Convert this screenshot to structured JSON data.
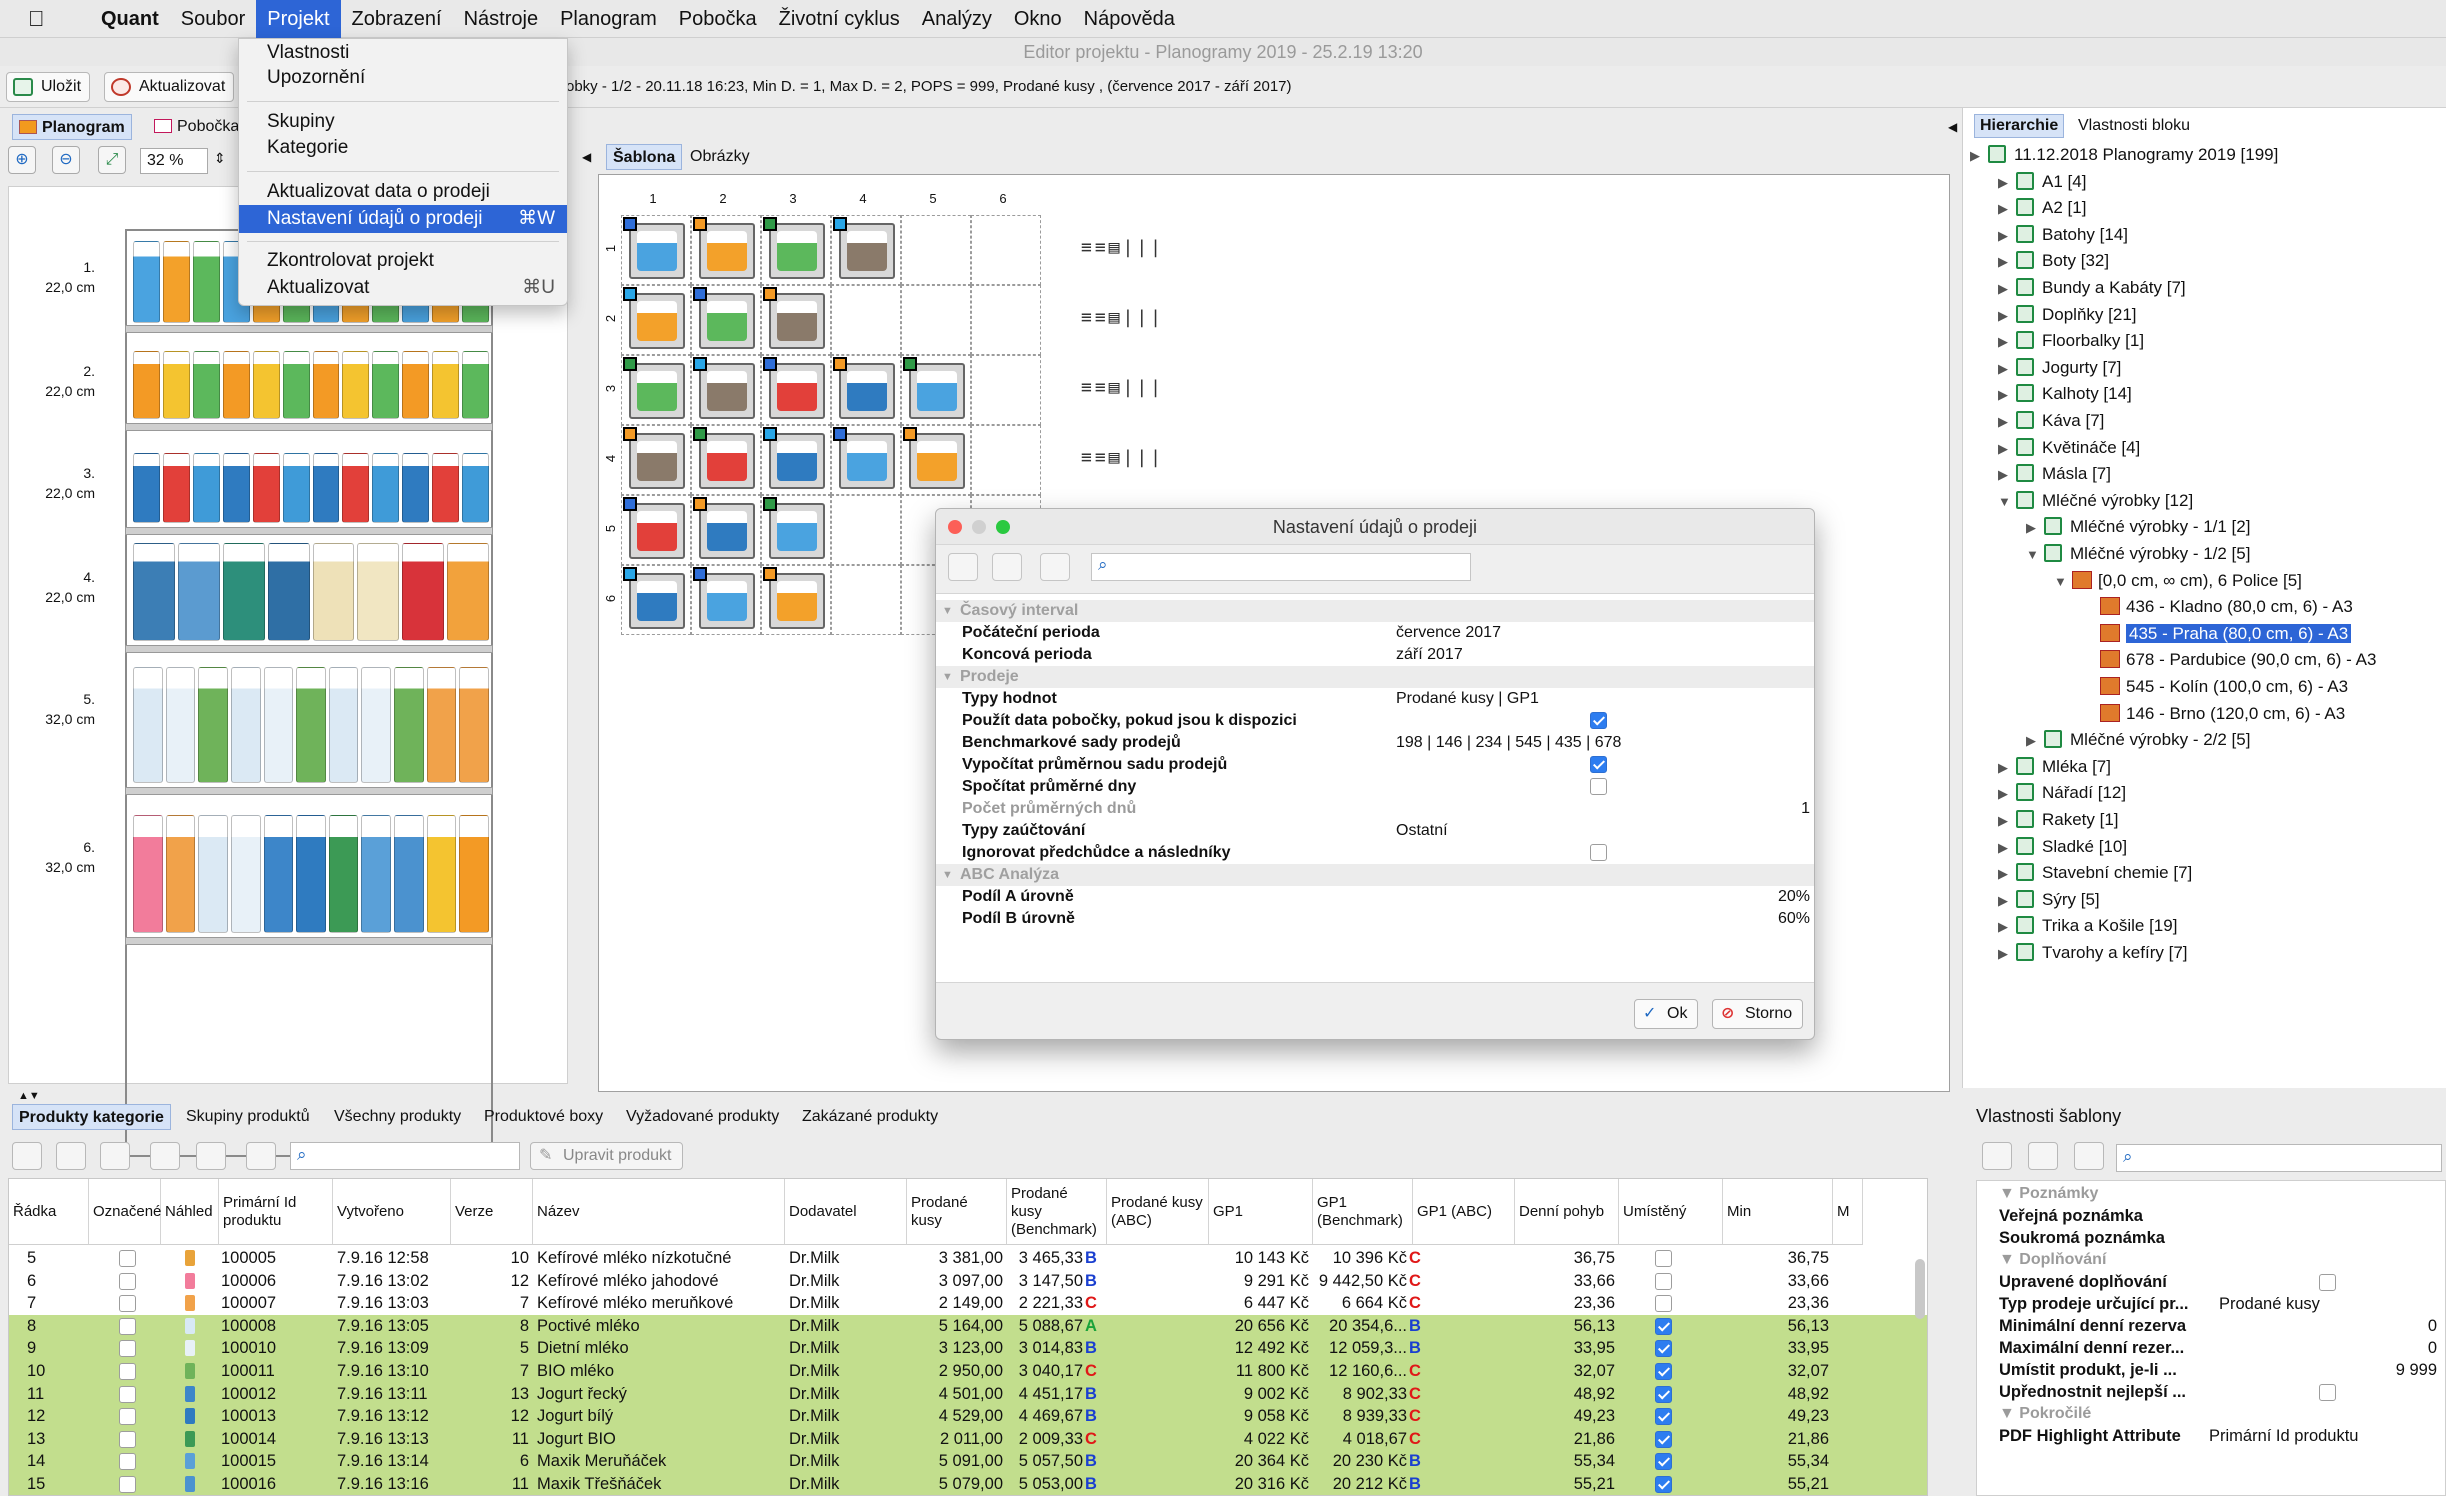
{
  "menubar": {
    "apple": "",
    "items": [
      "Quant",
      "Soubor",
      "Projekt",
      "Zobrazení",
      "Nástroje",
      "Planogram",
      "Pobočka",
      "Životní cyklus",
      "Analýzy",
      "Okno",
      "Nápověda"
    ]
  },
  "window_title": "Editor projektu - Planogramy 2019 - 25.2.19 13:20",
  "toolbar": {
    "save": "Uložit",
    "update": "Aktualizovat",
    "info": "obky - 1/2 - 20.11.18 16:23, Min D. = 1, Max D. = 2, POPS = 999, Prodané kusy , (července 2017 - září 2017)"
  },
  "left_tabs": {
    "planogram": "Planogram",
    "branch": "Pobočka"
  },
  "zoom": "32 %",
  "shelves": [
    {
      "num": "1.",
      "height": "22,0 cm"
    },
    {
      "num": "2.",
      "height": "22,0 cm"
    },
    {
      "num": "3.",
      "height": "22,0 cm"
    },
    {
      "num": "4.",
      "height": "22,0 cm"
    },
    {
      "num": "5.",
      "height": "32,0 cm"
    },
    {
      "num": "6.",
      "height": "32,0 cm"
    }
  ],
  "center_tabs": {
    "template": "Šablona",
    "images": "Obrázky"
  },
  "template_grid": {
    "columns": [
      "1",
      "2",
      "3",
      "4",
      "5",
      "6"
    ],
    "rows": [
      "1",
      "2",
      "3",
      "4",
      "5",
      "6"
    ]
  },
  "dropdown": {
    "items": [
      {
        "label": "Vlastnosti"
      },
      {
        "label": "Upozornění"
      },
      {
        "label": "Skupiny"
      },
      {
        "label": "Kategorie"
      },
      {
        "label": "Aktualizovat data o prodeji"
      },
      {
        "label": "Nastavení údajů o prodeji",
        "shortcut": "⌘W",
        "highlighted": true
      },
      {
        "label": "Zkontrolovat projekt"
      },
      {
        "label": "Aktualizovat",
        "shortcut": "⌘U"
      }
    ]
  },
  "dialog": {
    "title": "Nastavení údajů o prodeji",
    "groups": {
      "time": "Časový interval",
      "sales": "Prodeje",
      "abc": "ABC Analýza"
    },
    "rows": {
      "start": {
        "key": "Počáteční perioda",
        "value": "července 2017"
      },
      "end": {
        "key": "Koncová perioda",
        "value": "září 2017"
      },
      "types": {
        "key": "Typy hodnot",
        "value": "Prodané kusy  | GP1"
      },
      "branch_data": {
        "key": "Použít data pobočky, pokud jsou k dispozici",
        "checked": true
      },
      "bench": {
        "key": "Benchmarkové sady prodejů",
        "value": "198 | 146 | 234 | 545 | 435 | 678"
      },
      "avg_set": {
        "key": "Vypočítat průměrnou sadu prodejů",
        "checked": true
      },
      "avg_days": {
        "key": "Spočítat průměrné dny",
        "checked": false
      },
      "num_days": {
        "key": "Počet průměrných dnů",
        "value": "1"
      },
      "posting": {
        "key": "Typy zaúčtování",
        "value": "Ostatní"
      },
      "ignore": {
        "key": "Ignorovat předchůdce a následníky",
        "checked": false
      },
      "share_a": {
        "key": "Podíl A úrovně",
        "value": "20%"
      },
      "share_b": {
        "key": "Podíl B úrovně",
        "value": "60%"
      }
    },
    "ok": "Ok",
    "cancel": "Storno"
  },
  "right_tabs": {
    "hierarchy": "Hierarchie",
    "block_props": "Vlastnosti bloku"
  },
  "tree": [
    {
      "label": "11.12.2018 Planogramy 2019 [199]",
      "level": 0,
      "arrow": "▶"
    },
    {
      "label": "A1 [4]",
      "level": 1,
      "arrow": "▶"
    },
    {
      "label": "A2 [1]",
      "level": 1,
      "arrow": "▶"
    },
    {
      "label": "Batohy [14]",
      "level": 1,
      "arrow": "▶"
    },
    {
      "label": "Boty [32]",
      "level": 1,
      "arrow": "▶"
    },
    {
      "label": "Bundy a Kabáty [7]",
      "level": 1,
      "arrow": "▶"
    },
    {
      "label": "Doplňky [21]",
      "level": 1,
      "arrow": "▶"
    },
    {
      "label": "Floorbalky [1]",
      "level": 1,
      "arrow": "▶"
    },
    {
      "label": "Jogurty [7]",
      "level": 1,
      "arrow": "▶"
    },
    {
      "label": "Kalhoty [14]",
      "level": 1,
      "arrow": "▶"
    },
    {
      "label": "Káva [7]",
      "level": 1,
      "arrow": "▶"
    },
    {
      "label": "Květináče [4]",
      "level": 1,
      "arrow": "▶"
    },
    {
      "label": "Másla [7]",
      "level": 1,
      "arrow": "▶"
    },
    {
      "label": "Mléčné výrobky [12]",
      "level": 1,
      "arrow": "▼"
    },
    {
      "label": "Mléčné výrobky - 1/1 [2]",
      "level": 2,
      "arrow": "▶"
    },
    {
      "label": "Mléčné výrobky - 1/2 [5]",
      "level": 2,
      "arrow": "▼"
    },
    {
      "label": "[0,0 cm, ∞ cm), 6 Police [5]",
      "level": 3,
      "arrow": "▼",
      "store": true
    },
    {
      "label": "436 - Kladno (80,0 cm, 6) - A3",
      "level": 4,
      "arrow": "",
      "store": true
    },
    {
      "label": "435 - Praha  (80,0 cm, 6) - A3",
      "level": 4,
      "arrow": "",
      "store": true,
      "selected": true
    },
    {
      "label": "678 - Pardubice  (90,0 cm, 6) - A3",
      "level": 4,
      "arrow": "",
      "store": true
    },
    {
      "label": "545 - Kolín (100,0 cm, 6) - A3",
      "level": 4,
      "arrow": "",
      "store": true
    },
    {
      "label": "146 - Brno (120,0 cm, 6) - A3",
      "level": 4,
      "arrow": "",
      "store": true
    },
    {
      "label": "Mléčné výrobky - 2/2 [5]",
      "level": 2,
      "arrow": "▶"
    },
    {
      "label": "Mléka [7]",
      "level": 1,
      "arrow": "▶"
    },
    {
      "label": "Nářadí [12]",
      "level": 1,
      "arrow": "▶"
    },
    {
      "label": "Rakety [1]",
      "level": 1,
      "arrow": "▶"
    },
    {
      "label": "Sladké [10]",
      "level": 1,
      "arrow": "▶"
    },
    {
      "label": "Stavební chemie [7]",
      "level": 1,
      "arrow": "▶"
    },
    {
      "label": "Sýry [5]",
      "level": 1,
      "arrow": "▶"
    },
    {
      "label": "Trika a Košile [19]",
      "level": 1,
      "arrow": "▶"
    },
    {
      "label": "Tvarohy a kefíry [7]",
      "level": 1,
      "arrow": "▶"
    }
  ],
  "bottom_tabs": [
    "Produkty kategorie",
    "Skupiny produktů",
    "Všechny produkty",
    "Produktové boxy",
    "Vyžadované produkty",
    "Zakázané produkty"
  ],
  "edit_product": "Upravit produkt",
  "grid": {
    "headers": [
      "Řádka",
      "Označené",
      "Náhled",
      "Primární Id produktu",
      "Vytvořeno",
      "Verze",
      "Název",
      "Dodavatel",
      "Prodané kusy",
      "Prodané kusy (Benchmark)",
      "Prodané kusy  (ABC)",
      "GP1",
      "GP1 (Benchmark)",
      "GP1 (ABC)",
      "Denní pohyb",
      "Umístěný",
      "Min",
      "M"
    ],
    "rows": [
      {
        "row": "5",
        "id": "100005",
        "created": "7.9.16 12:58",
        "ver": "10",
        "name": "Kefírové mléko nízkotučné",
        "sup": "Dr.Milk",
        "sold": "3 381,00",
        "bench": "3 465,33",
        "abc": "B",
        "gp1": "10 143 Kč",
        "gp1b": "10 396 Kč",
        "gp1abc": "C",
        "daily": "36,75",
        "placed": false,
        "min": "36,75",
        "green": false,
        "swatch": "#e8a33a"
      },
      {
        "row": "6",
        "id": "100006",
        "created": "7.9.16 13:02",
        "ver": "12",
        "name": "Kefírové mléko jahodové",
        "sup": "Dr.Milk",
        "sold": "3 097,00",
        "bench": "3 147,50",
        "abc": "B",
        "gp1": "9 291 Kč",
        "gp1b": "9 442,50 Kč",
        "gp1abc": "C",
        "daily": "33,66",
        "placed": false,
        "min": "33,66",
        "green": false,
        "swatch": "#f27c9b"
      },
      {
        "row": "7",
        "id": "100007",
        "created": "7.9.16 13:03",
        "ver": "7",
        "name": "Kefírové mléko meruňkové",
        "sup": "Dr.Milk",
        "sold": "2 149,00",
        "bench": "2 221,33",
        "abc": "C",
        "gp1": "6 447 Kč",
        "gp1b": "6 664 Kč",
        "gp1abc": "C",
        "daily": "23,36",
        "placed": false,
        "min": "23,36",
        "green": false,
        "swatch": "#f1a24a"
      },
      {
        "row": "8",
        "id": "100008",
        "created": "7.9.16 13:05",
        "ver": "8",
        "name": "Poctivé mléko",
        "sup": "Dr.Milk",
        "sold": "5 164,00",
        "bench": "5 088,67",
        "abc": "A",
        "gp1": "20 656 Kč",
        "gp1b": "20 354,6...",
        "gp1abc": "B",
        "daily": "56,13",
        "placed": true,
        "min": "56,13",
        "green": true,
        "swatch": "#d8e9f5"
      },
      {
        "row": "9",
        "id": "100010",
        "created": "7.9.16 13:09",
        "ver": "5",
        "name": "Dietní mléko",
        "sup": "Dr.Milk",
        "sold": "3 123,00",
        "bench": "3 014,83",
        "abc": "B",
        "gp1": "12 492 Kč",
        "gp1b": "12 059,3...",
        "gp1abc": "B",
        "daily": "33,95",
        "placed": true,
        "min": "33,95",
        "green": true,
        "swatch": "#e8f1f8"
      },
      {
        "row": "10",
        "id": "100011",
        "created": "7.9.16 13:10",
        "ver": "7",
        "name": "BIO mléko",
        "sup": "Dr.Milk",
        "sold": "2 950,00",
        "bench": "3 040,17",
        "abc": "C",
        "gp1": "11 800 Kč",
        "gp1b": "12 160,6...",
        "gp1abc": "C",
        "daily": "32,07",
        "placed": true,
        "min": "32,07",
        "green": true,
        "swatch": "#6fb35a"
      },
      {
        "row": "11",
        "id": "100012",
        "created": "7.9.16 13:11",
        "ver": "13",
        "name": "Jogurt řecký",
        "sup": "Dr.Milk",
        "sold": "4 501,00",
        "bench": "4 451,17",
        "abc": "B",
        "gp1": "9 002 Kč",
        "gp1b": "8 902,33",
        "gp1abc": "C",
        "daily": "48,92",
        "placed": true,
        "min": "48,92",
        "green": true,
        "swatch": "#3d86c9"
      },
      {
        "row": "12",
        "id": "100013",
        "created": "7.9.16 13:12",
        "ver": "12",
        "name": "Jogurt bílý",
        "sup": "Dr.Milk",
        "sold": "4 529,00",
        "bench": "4 469,67",
        "abc": "B",
        "gp1": "9 058 Kč",
        "gp1b": "8 939,33",
        "gp1abc": "C",
        "daily": "49,23",
        "placed": true,
        "min": "49,23",
        "green": true,
        "swatch": "#2f7bc0"
      },
      {
        "row": "13",
        "id": "100014",
        "created": "7.9.16 13:13",
        "ver": "11",
        "name": "Jogurt BIO",
        "sup": "Dr.Milk",
        "sold": "2 011,00",
        "bench": "2 009,33",
        "abc": "C",
        "gp1": "4 022 Kč",
        "gp1b": "4 018,67",
        "gp1abc": "C",
        "daily": "21,86",
        "placed": true,
        "min": "21,86",
        "green": true,
        "swatch": "#3c9a55"
      },
      {
        "row": "14",
        "id": "100015",
        "created": "7.9.16 13:14",
        "ver": "6",
        "name": "Maxik Meruňáček",
        "sup": "Dr.Milk",
        "sold": "5 091,00",
        "bench": "5 057,50",
        "abc": "B",
        "gp1": "20 364 Kč",
        "gp1b": "20 230 Kč",
        "gp1abc": "B",
        "daily": "55,34",
        "placed": true,
        "min": "55,34",
        "green": true,
        "swatch": "#5aa0d8"
      },
      {
        "row": "15",
        "id": "100016",
        "created": "7.9.16 13:16",
        "ver": "11",
        "name": "Maxik Třešňáček",
        "sup": "Dr.Milk",
        "sold": "5 079,00",
        "bench": "5 053,00",
        "abc": "B",
        "gp1": "20 316 Kč",
        "gp1b": "20 212 Kč",
        "gp1abc": "B",
        "daily": "55,21",
        "placed": true,
        "min": "55,21",
        "green": true,
        "swatch": "#4b92cf"
      }
    ]
  },
  "template_props": {
    "title": "Vlastnosti šablony",
    "groups": {
      "notes": "Poznámky",
      "replenish": "Doplňování",
      "advanced": "Pokročilé"
    },
    "public_note": "Veřejná poznámka",
    "private_note": "Soukromá poznámka",
    "adj_replenish": "Upravené doplňování",
    "sale_type": {
      "key": "Typ prodeje určující pr...",
      "value": "Prodané kusy"
    },
    "min_reserve": {
      "key": "Minimální denní rezerva",
      "value": "0"
    },
    "max_reserve": {
      "key": "Maximální denní rezer...",
      "value": "0"
    },
    "place_if": {
      "key": "Umístit produkt, je-li ...",
      "value": "9 999"
    },
    "prefer_best": "Upřednostnit nejlepší ...",
    "pdf": {
      "key": "PDF Highlight Attribute",
      "value": "Primární Id produktu"
    }
  },
  "colors": {
    "accent": "#2d65d6",
    "row_green": "#c2de8d",
    "abc_a": "#1aa23a",
    "abc_b": "#1a3fd0",
    "abc_c": "#e01818"
  }
}
